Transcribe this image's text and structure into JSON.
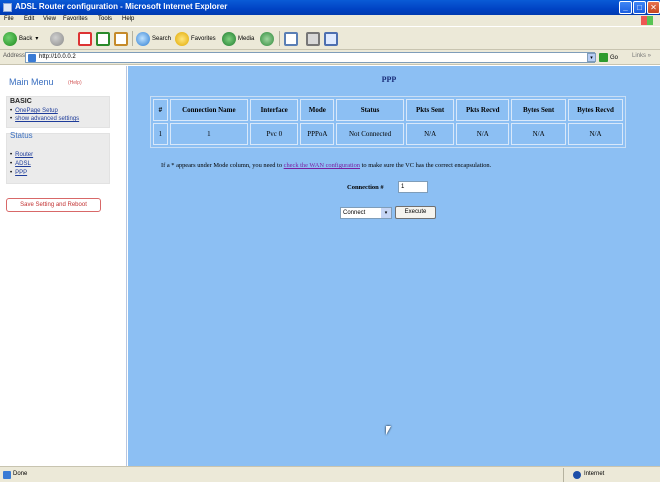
{
  "window": {
    "title": "ADSL Router configuration - Microsoft Internet Explorer",
    "min_icon": "_",
    "max_icon": "□",
    "close_icon": "✕"
  },
  "menu": [
    "File",
    "Edit",
    "View",
    "Favorites",
    "Tools",
    "Help"
  ],
  "toolbar": {
    "back_label": "Back",
    "search_label": "Search",
    "favorites_label": "Favorites",
    "media_label": "Media",
    "back_arrow": "▾"
  },
  "address": {
    "label": "Address",
    "url": "http://10.0.0.2",
    "go_label": "Go",
    "links_label": "Links »"
  },
  "nav": {
    "title": "Main Menu",
    "help": "(Help)",
    "basic_title": "BASIC",
    "basic_links": [
      "OnePage Setup",
      "show advanced settings"
    ],
    "status_title": "Status",
    "status_links": [
      "Router",
      "ADSL",
      "PPP"
    ],
    "save_button": "Save Setting and Reboot"
  },
  "content": {
    "title": "PPP",
    "table": {
      "headers": [
        "#",
        "Connection Name",
        "Interface",
        "Mode",
        "Status",
        "Pkts Sent",
        "Pkts Recvd",
        "Bytes Sent",
        "Bytes Recvd"
      ],
      "rows": [
        [
          "1",
          "1",
          "Pvc 0",
          "PPPoA",
          "Not Connected",
          "N/A",
          "N/A",
          "N/A",
          "N/A"
        ]
      ]
    },
    "note_before": "If a * appears under Mode column, you need to",
    "note_link": "check the WAN configuration",
    "note_after": "to make sure the VC has the correct encapsulation.",
    "connection_label": "Connection #",
    "connection_value": "1",
    "action_value": "Connect",
    "action_arrow": "▾",
    "execute_label": "Execute"
  },
  "status": {
    "text": "Done",
    "zone": "Internet"
  }
}
